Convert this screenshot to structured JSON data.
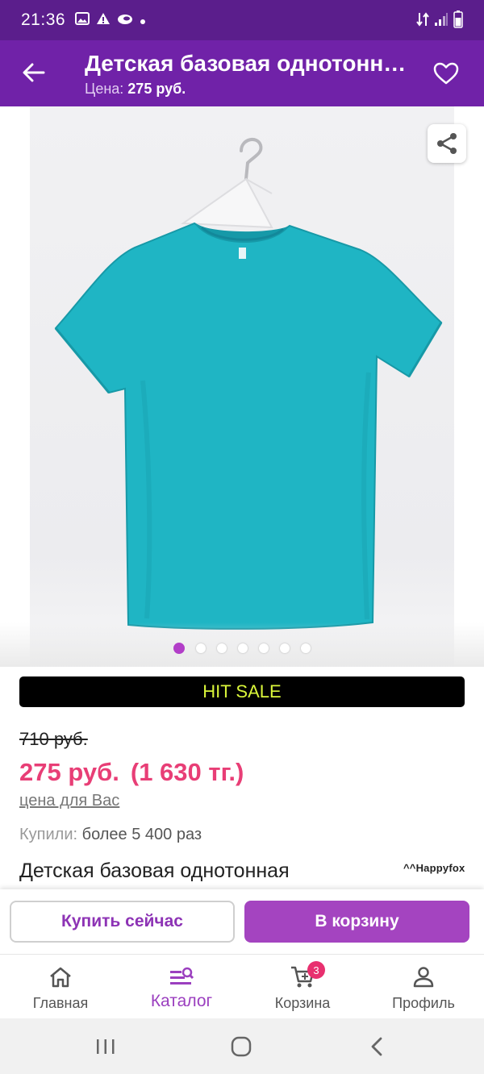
{
  "status_bar": {
    "time": "21:36",
    "icons": [
      "gallery-icon",
      "alert-icon",
      "cloud-icon",
      "dot-icon"
    ],
    "right_icons": [
      "data-arrows-icon",
      "signal-icon",
      "battery-icon"
    ]
  },
  "app_bar": {
    "title": "Детская базовая однотонная футболка",
    "subtitle_label": "Цена:",
    "subtitle_value": "275 руб."
  },
  "gallery": {
    "image_count": 7,
    "active_index": 0,
    "tshirt_color": "#1fb5c4"
  },
  "product": {
    "banner": "HIT SALE",
    "old_price": "710 руб.",
    "price": "275 руб.",
    "price_alt": "(1 630 тг.)",
    "price_note": "цена для Вас",
    "bought_label": "Купили:",
    "bought_value": "более 5 400 раз",
    "name": "Детская базовая однотонная",
    "brand": "^^Happyfox"
  },
  "actions": {
    "buy_now": "Купить сейчас",
    "add_to_cart": "В корзину"
  },
  "bottom_nav": {
    "items": [
      {
        "label": "Главная",
        "icon": "home-icon"
      },
      {
        "label": "Каталог",
        "icon": "catalog-search-icon"
      },
      {
        "label": "Корзина",
        "icon": "cart-icon"
      },
      {
        "label": "Профиль",
        "icon": "profile-icon"
      }
    ],
    "active": "Каталог",
    "cart_badge": "3"
  },
  "colors": {
    "status_bar": "#5b1e8c",
    "app_bar": "#7022a8",
    "accent": "#a444c0",
    "price": "#e83e76",
    "banner_text": "#d9f53a"
  }
}
